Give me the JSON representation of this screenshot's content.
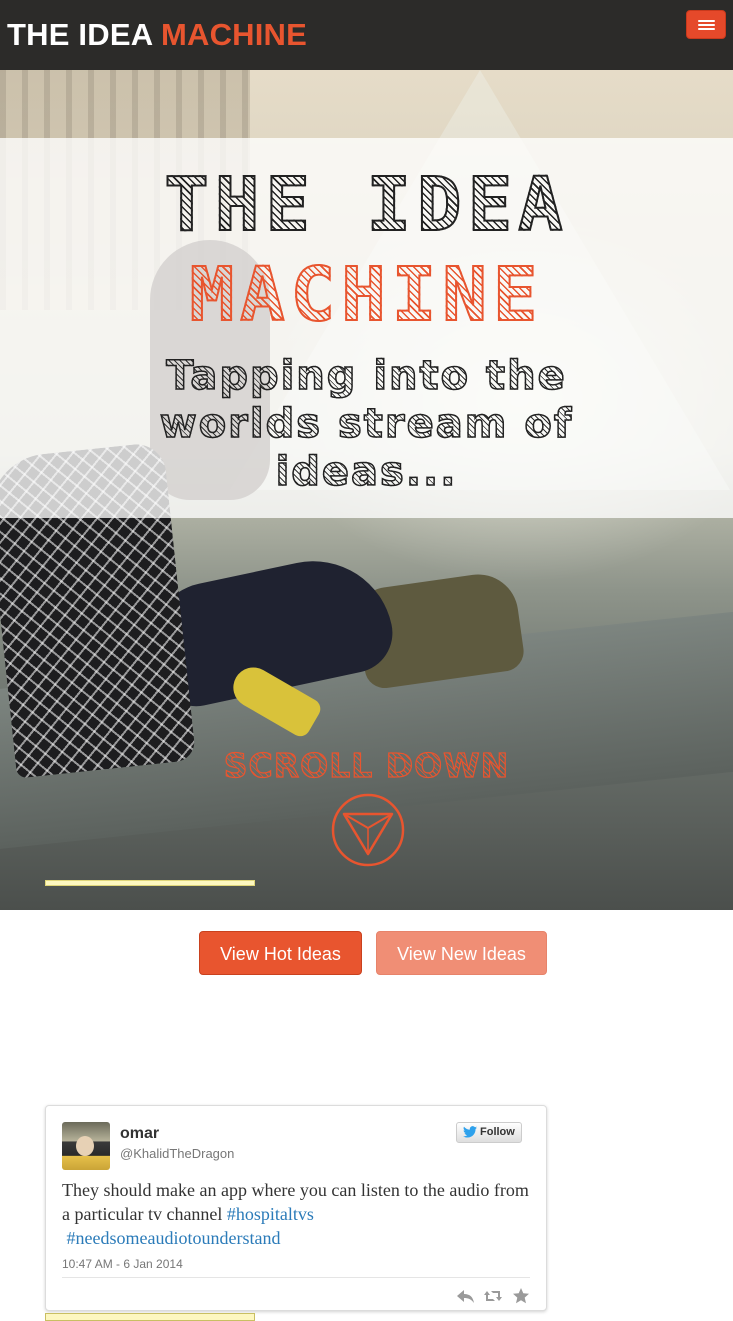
{
  "navbar": {
    "brand_part1": "THE IDEA ",
    "brand_part2": "MACHINE",
    "menu_icon": "hamburger-menu-icon",
    "accent_color": "#e8552f",
    "background_color": "#2c2b29"
  },
  "hero": {
    "title_line1": "THE IDEA",
    "title_line2": "MACHINE",
    "tagline": "Tapping into the worlds stream of ideas...",
    "scroll_label": "SCROLL DOWN",
    "scroll_icon": "chevron-down-circle-icon"
  },
  "actions": {
    "hot_ideas_label": "View Hot Ideas",
    "new_ideas_label": "View New Ideas"
  },
  "tweet": {
    "name": "omar",
    "handle": "@KhalidTheDragon",
    "follow_label": "Follow",
    "text_before": "They should make an app where you can listen to the audio from a particular tv channel ",
    "hashtag1": "#hospitaltvs",
    "hashtag2": "#needsomeaudiotounderstand",
    "timestamp": "10:47 AM - 6 Jan 2014",
    "action_icons": [
      "reply-icon",
      "retweet-icon",
      "favorite-star-icon"
    ],
    "link_color": "#2b7bb9"
  }
}
